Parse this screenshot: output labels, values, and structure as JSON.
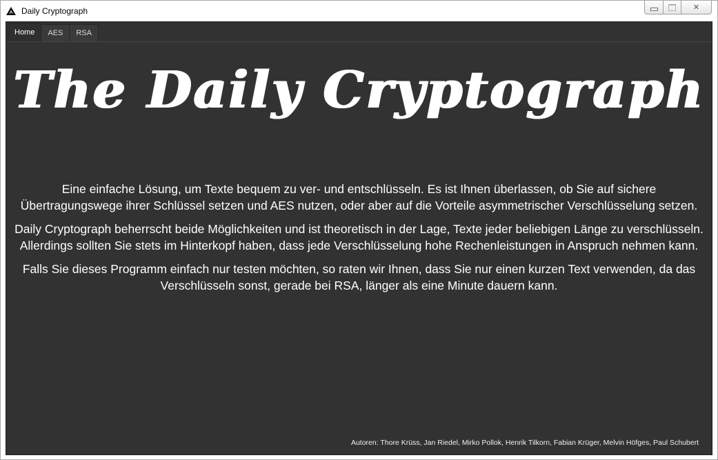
{
  "window": {
    "title": "Daily Cryptograph",
    "icon": "triangle-logo-icon",
    "controls": {
      "minimize": "minimize-icon",
      "maximize": "maximize-icon",
      "close_label": "✕"
    }
  },
  "tabs": [
    {
      "label": "Home",
      "active": true
    },
    {
      "label": "AES",
      "active": false
    },
    {
      "label": "RSA",
      "active": false
    }
  ],
  "home": {
    "masthead": "The Daily Cryptograph",
    "paragraphs": [
      "Eine einfache Lösung, um Texte bequem zu ver- und entschlüsseln. Es ist Ihnen überlassen, ob Sie auf sichere Übertragungswege ihrer Schlüssel setzen und AES nutzen, oder aber auf die Vorteile asymmetrischer Verschlüsselung setzen.",
      "Daily Cryptograph beherrscht beide Möglichkeiten und ist theoretisch in der Lage, Texte jeder beliebigen Länge zu verschlüsseln. Allerdings sollten Sie stets im Hinterkopf haben, dass jede Verschlüsselung hohe Rechenleistungen in Anspruch nehmen kann.",
      "Falls Sie dieses Programm einfach nur testen möchten, so raten wir Ihnen, dass Sie nur einen kurzen Text verwenden, da das Verschlüsseln sonst, gerade bei RSA, länger als eine Minute dauern kann."
    ],
    "authors": "Autoren: Thore Krüss, Jan Riedel, Mirko Pollok, Henrik Tilkorn, Fabian Krüger, Melvin Höfges, Paul Schubert"
  },
  "colors": {
    "background": "#323232",
    "text": "#ffffff",
    "titlebar": "#ffffff"
  }
}
